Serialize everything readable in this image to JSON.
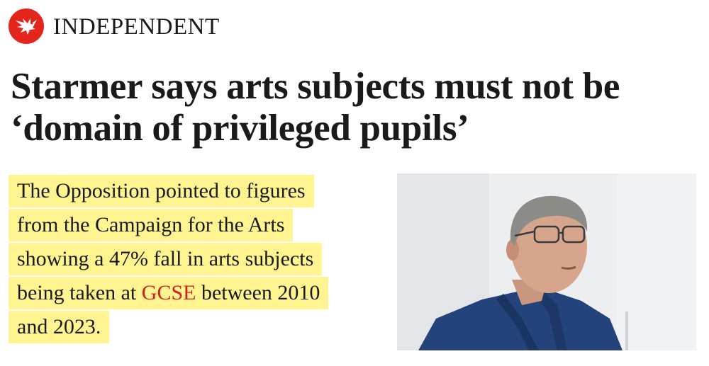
{
  "masthead": {
    "brand": "INDEPENDENT",
    "logo_icon": "eagle-icon",
    "logo_color": "#e4251b"
  },
  "article": {
    "headline_line1": "Starmer says arts subjects must not be",
    "headline_line2": "‘domain of privileged pupils’",
    "excerpt": {
      "line1": "The Opposition pointed to figures",
      "line2": "from the Campaign for the Arts",
      "line3": "showing a 47% fall in arts subjects",
      "line4_pre": "being taken at ",
      "line4_link": "GCSE",
      "line4_post": " between 2010",
      "line5": "and 2023."
    },
    "highlight_color": "#fff48f",
    "link_color": "#d21e1e"
  }
}
